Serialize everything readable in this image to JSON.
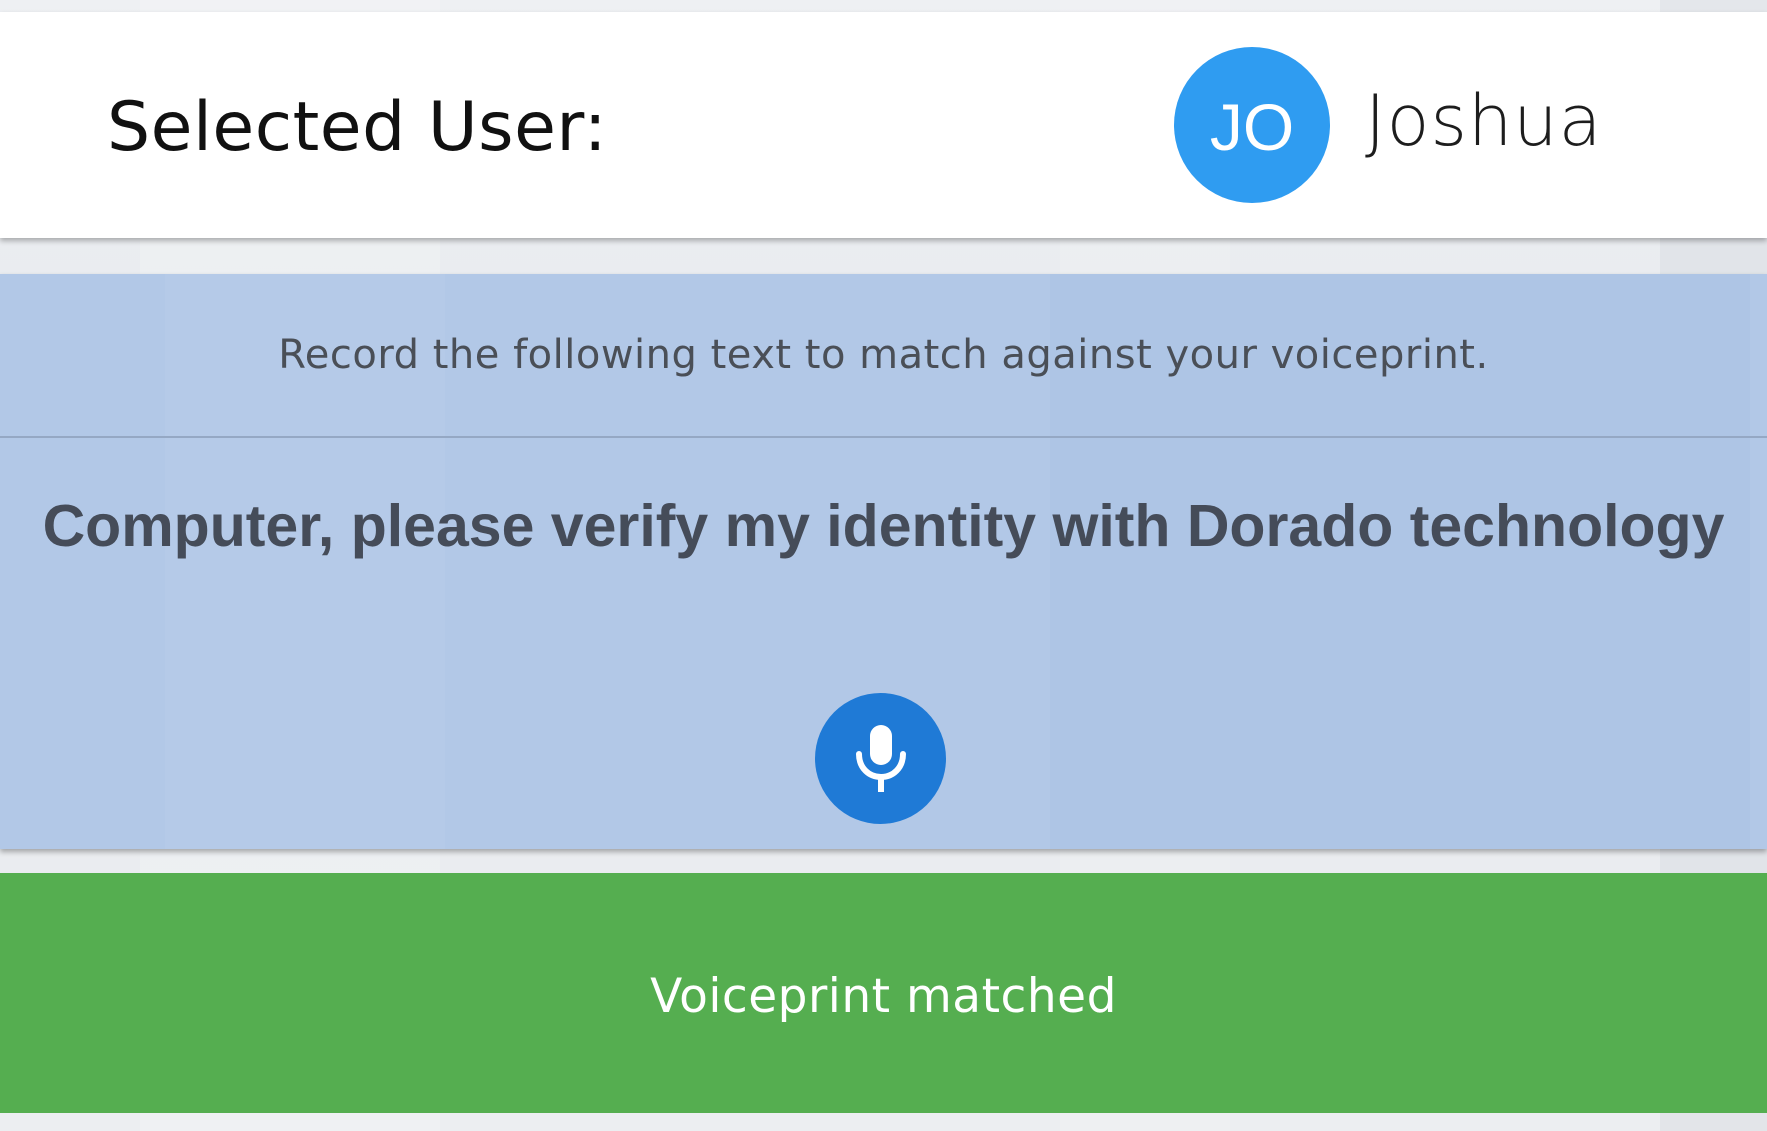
{
  "header": {
    "selected_label": "Selected User:",
    "user": {
      "initials": "JO",
      "name": "Joshua",
      "avatar_color": "#2f9cf1"
    }
  },
  "recording": {
    "instruction": "Record the following text to match against your voiceprint.",
    "phrase": "Computer, please verify my identity with Dorado technology",
    "mic_icon": "microphone-icon",
    "panel_color": "#b2c8e7",
    "button_color": "#1f7ad6"
  },
  "status": {
    "message": "Voiceprint matched",
    "color": "#55ae50"
  }
}
